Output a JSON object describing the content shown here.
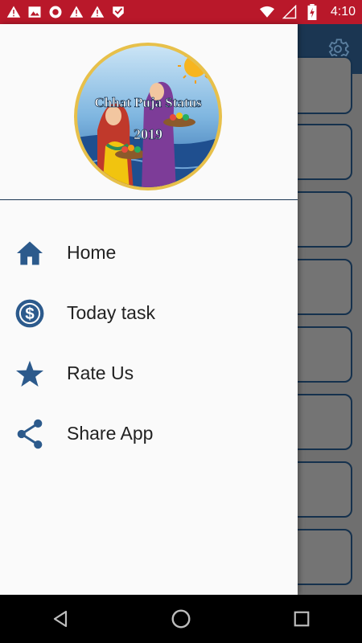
{
  "status_bar": {
    "time": "4:10",
    "icons": [
      "warning-icon",
      "image-icon",
      "circle-icon",
      "warning-icon",
      "warning-icon",
      "check-badge-icon",
      "wifi-icon",
      "signal-icon",
      "battery-icon"
    ],
    "background_color": "#b9182a"
  },
  "header": {
    "logo_title": "Chhat Puja Status",
    "logo_year": "2019"
  },
  "menu": {
    "items": [
      {
        "label": "Home",
        "icon": "home-icon"
      },
      {
        "label": "Today task",
        "icon": "dollar-icon"
      },
      {
        "label": "Rate Us",
        "icon": "star-icon"
      },
      {
        "label": "Share App",
        "icon": "share-icon"
      }
    ]
  },
  "colors": {
    "accent": "#2c5a8c",
    "toolbar": "#1b3652",
    "drawer_bg": "#fafafa"
  },
  "background_app": {
    "settings_icon": "gear-icon"
  },
  "nav_bar": {
    "buttons": [
      "back-icon",
      "home-circle-icon",
      "recents-icon"
    ]
  }
}
